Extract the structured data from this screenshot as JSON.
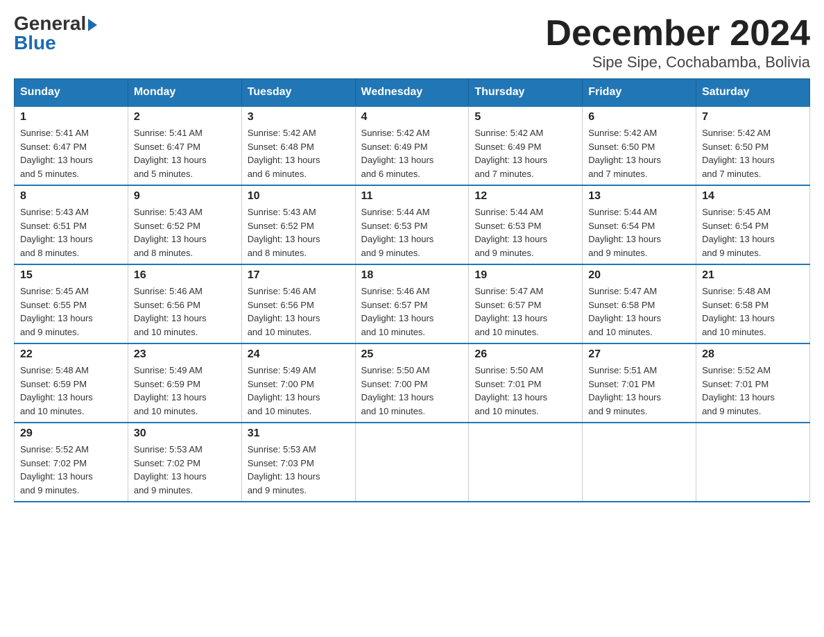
{
  "logo": {
    "general": "General",
    "blue": "Blue"
  },
  "header": {
    "month_year": "December 2024",
    "location": "Sipe Sipe, Cochabamba, Bolivia"
  },
  "days_of_week": [
    "Sunday",
    "Monday",
    "Tuesday",
    "Wednesday",
    "Thursday",
    "Friday",
    "Saturday"
  ],
  "weeks": [
    [
      {
        "day": "1",
        "sunrise": "5:41 AM",
        "sunset": "6:47 PM",
        "daylight": "13 hours and 5 minutes."
      },
      {
        "day": "2",
        "sunrise": "5:41 AM",
        "sunset": "6:47 PM",
        "daylight": "13 hours and 5 minutes."
      },
      {
        "day": "3",
        "sunrise": "5:42 AM",
        "sunset": "6:48 PM",
        "daylight": "13 hours and 6 minutes."
      },
      {
        "day": "4",
        "sunrise": "5:42 AM",
        "sunset": "6:49 PM",
        "daylight": "13 hours and 6 minutes."
      },
      {
        "day": "5",
        "sunrise": "5:42 AM",
        "sunset": "6:49 PM",
        "daylight": "13 hours and 7 minutes."
      },
      {
        "day": "6",
        "sunrise": "5:42 AM",
        "sunset": "6:50 PM",
        "daylight": "13 hours and 7 minutes."
      },
      {
        "day": "7",
        "sunrise": "5:42 AM",
        "sunset": "6:50 PM",
        "daylight": "13 hours and 7 minutes."
      }
    ],
    [
      {
        "day": "8",
        "sunrise": "5:43 AM",
        "sunset": "6:51 PM",
        "daylight": "13 hours and 8 minutes."
      },
      {
        "day": "9",
        "sunrise": "5:43 AM",
        "sunset": "6:52 PM",
        "daylight": "13 hours and 8 minutes."
      },
      {
        "day": "10",
        "sunrise": "5:43 AM",
        "sunset": "6:52 PM",
        "daylight": "13 hours and 8 minutes."
      },
      {
        "day": "11",
        "sunrise": "5:44 AM",
        "sunset": "6:53 PM",
        "daylight": "13 hours and 9 minutes."
      },
      {
        "day": "12",
        "sunrise": "5:44 AM",
        "sunset": "6:53 PM",
        "daylight": "13 hours and 9 minutes."
      },
      {
        "day": "13",
        "sunrise": "5:44 AM",
        "sunset": "6:54 PM",
        "daylight": "13 hours and 9 minutes."
      },
      {
        "day": "14",
        "sunrise": "5:45 AM",
        "sunset": "6:54 PM",
        "daylight": "13 hours and 9 minutes."
      }
    ],
    [
      {
        "day": "15",
        "sunrise": "5:45 AM",
        "sunset": "6:55 PM",
        "daylight": "13 hours and 9 minutes."
      },
      {
        "day": "16",
        "sunrise": "5:46 AM",
        "sunset": "6:56 PM",
        "daylight": "13 hours and 10 minutes."
      },
      {
        "day": "17",
        "sunrise": "5:46 AM",
        "sunset": "6:56 PM",
        "daylight": "13 hours and 10 minutes."
      },
      {
        "day": "18",
        "sunrise": "5:46 AM",
        "sunset": "6:57 PM",
        "daylight": "13 hours and 10 minutes."
      },
      {
        "day": "19",
        "sunrise": "5:47 AM",
        "sunset": "6:57 PM",
        "daylight": "13 hours and 10 minutes."
      },
      {
        "day": "20",
        "sunrise": "5:47 AM",
        "sunset": "6:58 PM",
        "daylight": "13 hours and 10 minutes."
      },
      {
        "day": "21",
        "sunrise": "5:48 AM",
        "sunset": "6:58 PM",
        "daylight": "13 hours and 10 minutes."
      }
    ],
    [
      {
        "day": "22",
        "sunrise": "5:48 AM",
        "sunset": "6:59 PM",
        "daylight": "13 hours and 10 minutes."
      },
      {
        "day": "23",
        "sunrise": "5:49 AM",
        "sunset": "6:59 PM",
        "daylight": "13 hours and 10 minutes."
      },
      {
        "day": "24",
        "sunrise": "5:49 AM",
        "sunset": "7:00 PM",
        "daylight": "13 hours and 10 minutes."
      },
      {
        "day": "25",
        "sunrise": "5:50 AM",
        "sunset": "7:00 PM",
        "daylight": "13 hours and 10 minutes."
      },
      {
        "day": "26",
        "sunrise": "5:50 AM",
        "sunset": "7:01 PM",
        "daylight": "13 hours and 10 minutes."
      },
      {
        "day": "27",
        "sunrise": "5:51 AM",
        "sunset": "7:01 PM",
        "daylight": "13 hours and 9 minutes."
      },
      {
        "day": "28",
        "sunrise": "5:52 AM",
        "sunset": "7:01 PM",
        "daylight": "13 hours and 9 minutes."
      }
    ],
    [
      {
        "day": "29",
        "sunrise": "5:52 AM",
        "sunset": "7:02 PM",
        "daylight": "13 hours and 9 minutes."
      },
      {
        "day": "30",
        "sunrise": "5:53 AM",
        "sunset": "7:02 PM",
        "daylight": "13 hours and 9 minutes."
      },
      {
        "day": "31",
        "sunrise": "5:53 AM",
        "sunset": "7:03 PM",
        "daylight": "13 hours and 9 minutes."
      },
      null,
      null,
      null,
      null
    ]
  ],
  "labels": {
    "sunrise": "Sunrise:",
    "sunset": "Sunset:",
    "daylight": "Daylight:"
  }
}
